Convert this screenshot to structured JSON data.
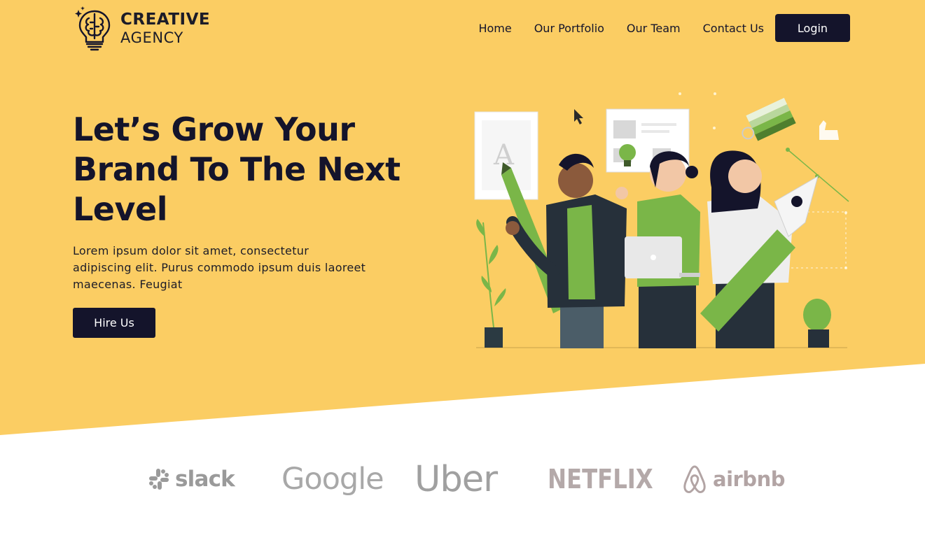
{
  "brand": {
    "name_line1": "CREATIVE",
    "name_line2": "AGENCY",
    "logo_icon": "lightbulb-brain-icon"
  },
  "nav": {
    "items": [
      {
        "label": "Home"
      },
      {
        "label": "Our Portfolio"
      },
      {
        "label": "Our Team"
      },
      {
        "label": "Contact Us"
      }
    ],
    "login_label": "Login"
  },
  "hero": {
    "headline": "Let’s Grow Your Brand To The Next Level",
    "subtext": "Lorem ipsum dolor sit amet, consectetur adipiscing elit. Purus commodo ipsum duis laoreet maecenas. Feugiat",
    "cta_label": "Hire Us",
    "illustration_letter": "A"
  },
  "clients": {
    "logos": [
      {
        "label": "slack",
        "icon": "slack-icon"
      },
      {
        "label": "Google"
      },
      {
        "label": "Uber"
      },
      {
        "label": "NETFLIX"
      },
      {
        "label": "airbnb",
        "icon": "airbnb-icon"
      }
    ]
  },
  "colors": {
    "hero_background": "#fbcd63",
    "dark_navy": "#14142b",
    "accent_green": "#7ab648",
    "logo_gray": "#a3a3a3"
  }
}
